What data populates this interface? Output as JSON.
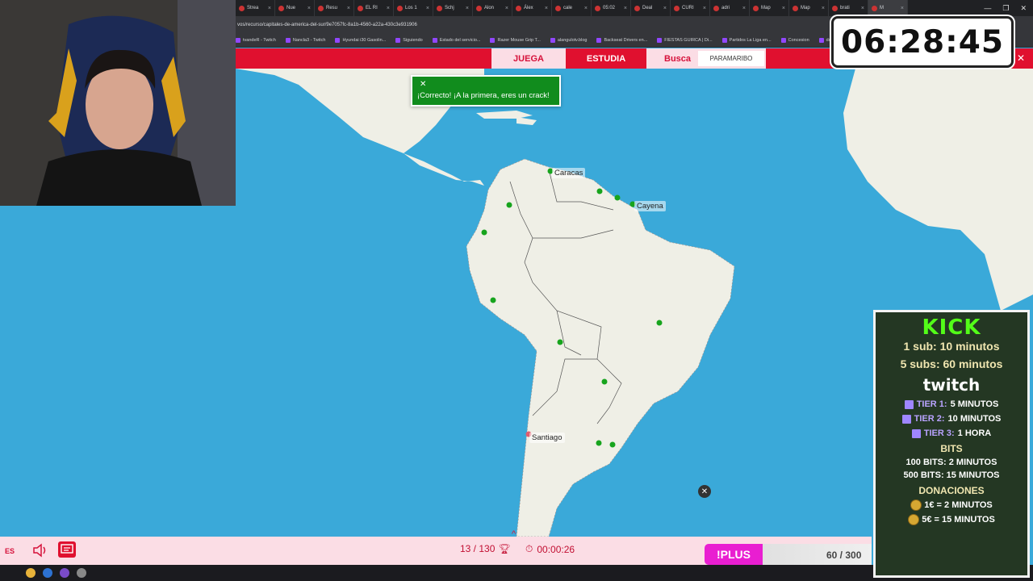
{
  "browser": {
    "tabs": [
      "Strea",
      "Nue",
      "Resu",
      "EL RI",
      "Los 1",
      "Schj",
      "Alon",
      "Álex",
      "cale",
      "05:02",
      "Deal",
      "CURI",
      "adri",
      "Map",
      "Map",
      "brati",
      "M"
    ],
    "url": "vos/recurso/capitales-de-america-del-sur/9e7057fc-8a1b-4560-a22a-430c3e931906",
    "bookmarks": [
      "tvandeR - Twitch",
      "Nancla3 - Twitch",
      "Hyundai i30 Gasolin...",
      "Siguiendo",
      "Estado del servicio...",
      "Razer Mouse Grip T...",
      "alangulotv.blog",
      "Backseat Drivers en...",
      "FIESTAS GUIRCA | Di...",
      "Partidos La Liga en...",
      "Concesion",
      "dores"
    ]
  },
  "nav": {
    "juega": "JUEGA",
    "estudia": "ESTUDIA",
    "busca": "Busca",
    "target_city": "PARAMARIBO"
  },
  "toast": {
    "message": "¡Correcto! ¡A la primera, eres un crack!"
  },
  "map": {
    "labels": {
      "caracas": "Caracas",
      "cayena": "Cayena",
      "santiago": "Santiago"
    }
  },
  "game": {
    "language": "ES",
    "score": "13 / 130",
    "elapsed": "00:00:26"
  },
  "plus": {
    "label": "!PLUS",
    "count": "60 / 300"
  },
  "overlay_timer": "06:28:45",
  "donations": {
    "kick_title": "KICK",
    "kick_line1": "1 sub: 10 minutos",
    "kick_line2": "5 subs: 60 minutos",
    "twitch_title": "twitch",
    "tier1_label": "TIER 1:",
    "tier1_value": "5 MINUTOS",
    "tier2_label": "TIER 2:",
    "tier2_value": "10 MINUTOS",
    "tier3_label": "TIER 3:",
    "tier3_value": "1 HORA",
    "bits_title": "BITS",
    "bits1": "100 BITS: 2 MINUTOS",
    "bits2": "500 BITS: 15 MINUTOS",
    "donaciones_title": "DONACIONES",
    "don1": "1€ = 2 MINUTOS",
    "don2": "5€ = 15 MINUTOS"
  },
  "colors": {
    "brand_red": "#e0102f",
    "ocean": "#3aa9d9",
    "land": "#efefe6",
    "correct_green": "#118c1d",
    "kick_green": "#53fc18"
  }
}
